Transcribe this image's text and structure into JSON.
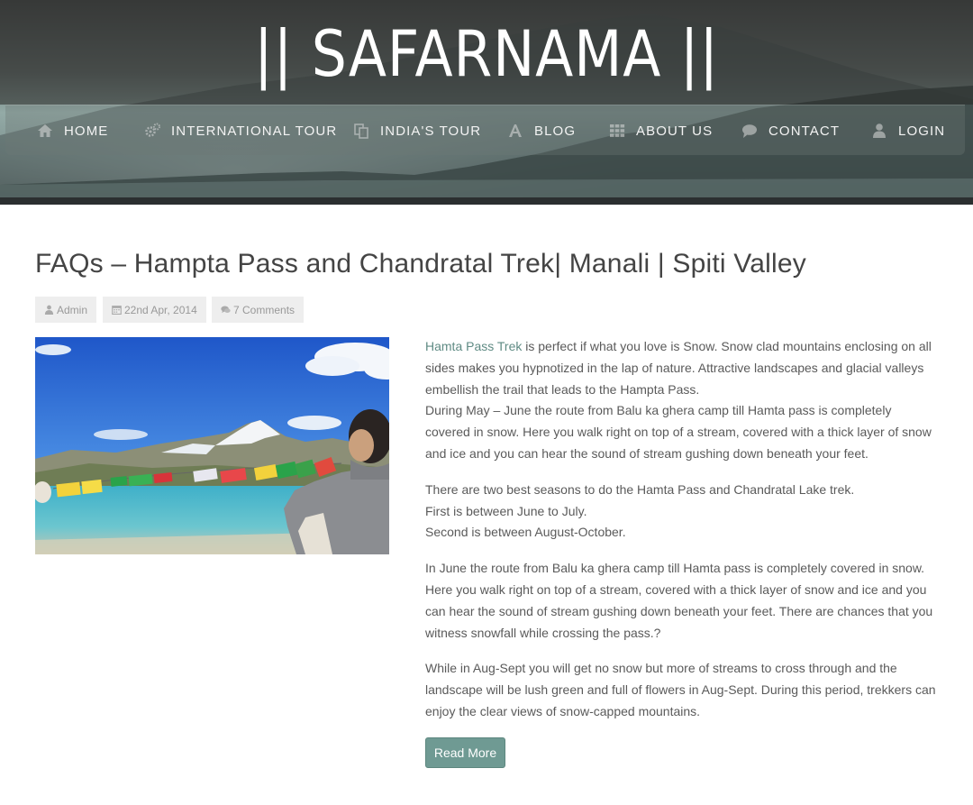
{
  "site": {
    "title": "|| SAFARNAMA ||"
  },
  "nav": {
    "items": [
      {
        "label": "HOME",
        "icon": "home-icon"
      },
      {
        "label": "INTERNATIONAL TOUR",
        "icon": "gears-icon"
      },
      {
        "label": "INDIA'S TOUR",
        "icon": "copy-icon"
      },
      {
        "label": "BLOG",
        "icon": "font-icon"
      },
      {
        "label": "ABOUT US",
        "icon": "grid-icon"
      },
      {
        "label": "CONTACT",
        "icon": "comment-icon"
      },
      {
        "label": "LOGIN",
        "icon": "user-icon"
      }
    ]
  },
  "post": {
    "title": "FAQs – Hampta Pass and Chandratal Trek| Manali | Spiti Valley",
    "meta": {
      "author": "Admin",
      "date": "22nd Apr, 2014",
      "comments": "7 Comments"
    },
    "image_alt": "Prayer flags by a lake with snow-capped mountains",
    "link_text": "Hamta Pass Trek",
    "p1_rest": " is perfect if what you love is Snow. Snow clad mountains enclosing on all sides makes you hypnotized in the lap of nature. Attractive landscapes and glacial valleys embellish the trail that leads to the Hampta Pass.",
    "p1_line2": "During May – June the route from Balu ka ghera camp till Hamta pass is completely covered in snow. Here you walk right on top of a stream, covered with a thick layer of snow and ice and you can hear the sound of stream gushing down beneath your feet.",
    "p2_line1": "There are two best seasons to do the Hamta Pass and Chandratal Lake trek.",
    "p2_line2": "First is between June to July.",
    "p2_line3": "Second is between August-October.",
    "p3": "In June the route from Balu ka ghera camp till Hamta pass is completely covered in snow. Here you walk right on top of a stream, covered with a thick layer of snow and ice and you can hear the sound of stream gushing down beneath your feet. There are chances that you witness snowfall while crossing the pass.?",
    "p4": "While in Aug-Sept you will get no snow but more of streams to cross through and the landscape will be lush green and full of flowers in Aug-Sept. During this period, trekkers can enjoy the clear views of snow-capped mountains.",
    "read_more": "Read More"
  },
  "colors": {
    "accent": "#6f9a93",
    "link": "#5f8b84",
    "meta_bg": "#eeeeee"
  }
}
